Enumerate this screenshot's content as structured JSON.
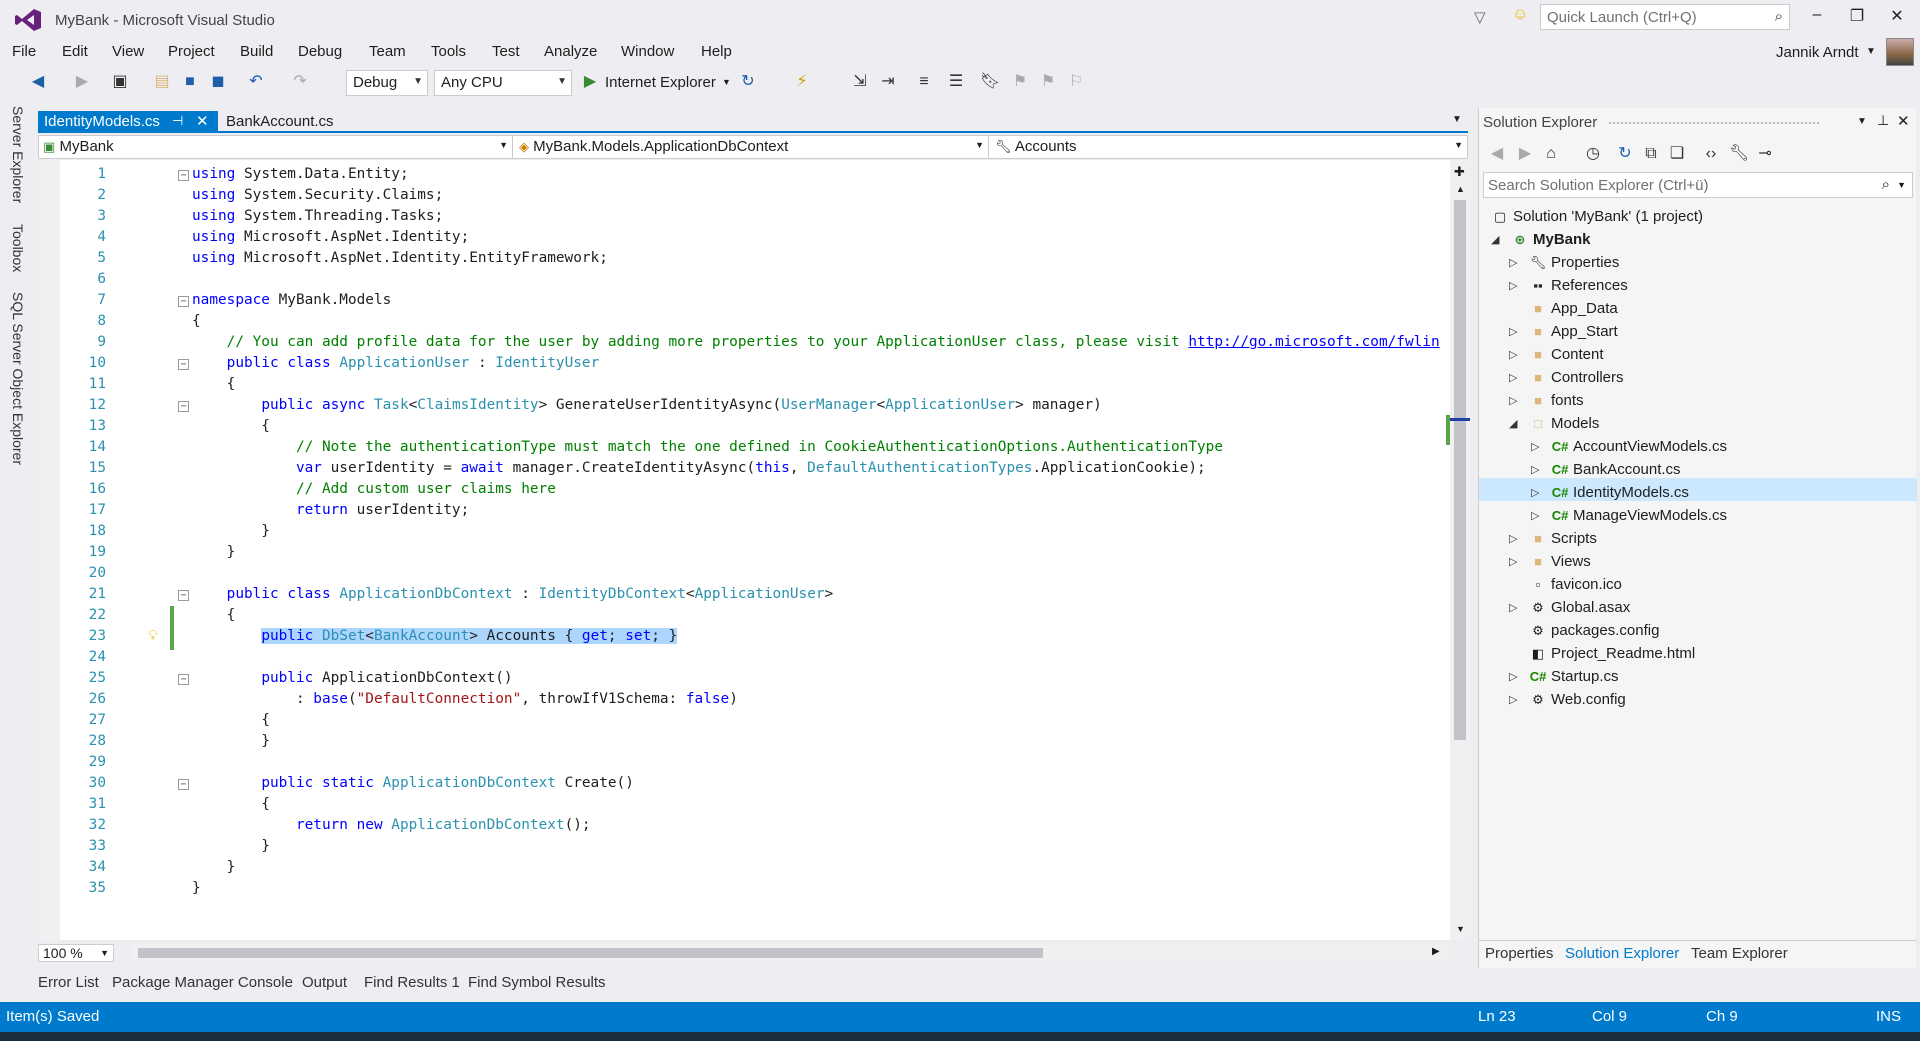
{
  "window": {
    "title": "MyBank - Microsoft Visual Studio",
    "quick_launch_placeholder": "Quick Launch (Ctrl+Q)",
    "user": "Jannik Arndt"
  },
  "menu": [
    "File",
    "Edit",
    "View",
    "Project",
    "Build",
    "Debug",
    "Team",
    "Tools",
    "Test",
    "Analyze",
    "Window",
    "Help"
  ],
  "toolbar": {
    "config": "Debug",
    "platform": "Any CPU",
    "run_target": "Internet Explorer"
  },
  "left_tabs": [
    "Server Explorer",
    "Toolbox",
    "SQL Server Object Explorer"
  ],
  "doc_tabs": {
    "active": "IdentityModels.cs",
    "inactive": "BankAccount.cs"
  },
  "navbar": {
    "project": "MyBank",
    "type": "MyBank.Models.ApplicationDbContext",
    "member": "Accounts"
  },
  "code_lines": [
    "using System.Data.Entity;",
    "using System.Security.Claims;",
    "using System.Threading.Tasks;",
    "using Microsoft.AspNet.Identity;",
    "using Microsoft.AspNet.Identity.EntityFramework;",
    "",
    "namespace MyBank.Models",
    "{",
    "    // You can add profile data for the user by adding more properties to your ApplicationUser class, please visit http://go.microsoft.com/fwlin",
    "    public class ApplicationUser : IdentityUser",
    "    {",
    "        public async Task<ClaimsIdentity> GenerateUserIdentityAsync(UserManager<ApplicationUser> manager)",
    "        {",
    "            // Note the authenticationType must match the one defined in CookieAuthenticationOptions.AuthenticationType",
    "            var userIdentity = await manager.CreateIdentityAsync(this, DefaultAuthenticationTypes.ApplicationCookie);",
    "            // Add custom user claims here",
    "            return userIdentity;",
    "        }",
    "    }",
    "",
    "    public class ApplicationDbContext : IdentityDbContext<ApplicationUser>",
    "    {",
    "        public DbSet<BankAccount> Accounts { get; set; }",
    "",
    "        public ApplicationDbContext()",
    "            : base(\"DefaultConnection\", throwIfV1Schema: false)",
    "        {",
    "        }",
    "",
    "        public static ApplicationDbContext Create()",
    "        {",
    "            return new ApplicationDbContext();",
    "        }",
    "    }",
    "}"
  ],
  "editor": {
    "zoom": "100 %"
  },
  "bottom_tabs": [
    "Error List",
    "Package Manager Console",
    "Output",
    "Find Results 1",
    "Find Symbol Results"
  ],
  "solution_explorer": {
    "title": "Solution Explorer",
    "search_placeholder": "Search Solution Explorer (Ctrl+ü)",
    "solution": "Solution 'MyBank' (1 project)",
    "project": "MyBank",
    "items": [
      {
        "label": "Properties",
        "kind": "wrench"
      },
      {
        "label": "References",
        "kind": "refs"
      },
      {
        "label": "App_Data",
        "kind": "folder"
      },
      {
        "label": "App_Start",
        "kind": "folder"
      },
      {
        "label": "Content",
        "kind": "folder"
      },
      {
        "label": "Controllers",
        "kind": "folder"
      },
      {
        "label": "fonts",
        "kind": "folder"
      },
      {
        "label": "Models",
        "kind": "folder"
      },
      {
        "label": "AccountViewModels.cs",
        "kind": "cs"
      },
      {
        "label": "BankAccount.cs",
        "kind": "cs"
      },
      {
        "label": "IdentityModels.cs",
        "kind": "cs"
      },
      {
        "label": "ManageViewModels.cs",
        "kind": "cs"
      },
      {
        "label": "Scripts",
        "kind": "folder"
      },
      {
        "label": "Views",
        "kind": "folder"
      },
      {
        "label": "favicon.ico",
        "kind": "file"
      },
      {
        "label": "Global.asax",
        "kind": "file"
      },
      {
        "label": "packages.config",
        "kind": "file"
      },
      {
        "label": "Project_Readme.html",
        "kind": "file"
      },
      {
        "label": "Startup.cs",
        "kind": "cs"
      },
      {
        "label": "Web.config",
        "kind": "file"
      }
    ],
    "tabs": [
      "Properties",
      "Solution Explorer",
      "Team Explorer"
    ]
  },
  "status": {
    "message": "Item(s) Saved",
    "ln": "Ln 23",
    "col": "Col 9",
    "ch": "Ch 9",
    "mode": "INS"
  },
  "colors": {
    "accent": "#007acc",
    "keyword": "#0000ff",
    "type": "#2b91af",
    "comment": "#008000",
    "string": "#a31515"
  }
}
